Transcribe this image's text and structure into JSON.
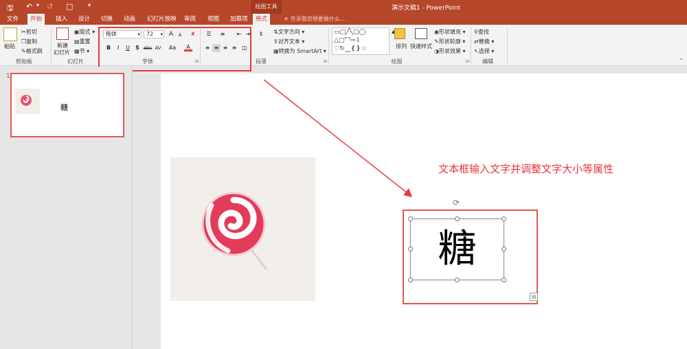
{
  "app": {
    "doc_title": "演示文稿1 - PowerPoint",
    "context_tab_group": "绘图工具",
    "tell_me_placeholder": "告诉我您想要做什么..."
  },
  "tabs": [
    "文件",
    "开始",
    "插入",
    "设计",
    "切换",
    "动画",
    "幻灯片放映",
    "审阅",
    "视图",
    "加载项",
    "格式"
  ],
  "active_tab": "开始",
  "ribbon": {
    "clipboard": {
      "paste": "粘贴",
      "cut": "剪切",
      "copy": "复制",
      "format_painter": "格式刷",
      "label": "剪贴板"
    },
    "slides": {
      "new_slide_1": "新建",
      "new_slide_2": "幻灯片",
      "layout": "版式",
      "reset": "重置",
      "section": "节",
      "label": "幻灯片"
    },
    "font": {
      "font_name": "楷体",
      "font_size": "72",
      "label": "字体",
      "bold": "B",
      "italic": "I",
      "underline": "U",
      "shadow": "S",
      "strike": "abc",
      "spacing": "AV",
      "case": "Aa",
      "grow": "A",
      "shrink": "A",
      "color": "A"
    },
    "paragraph": {
      "text_direction": "文字方向",
      "align_text": "对齐文本",
      "smartart": "转换为 SmartArt",
      "label": "段落"
    },
    "drawing": {
      "arrange": "排列",
      "quick_styles": "快速样式",
      "shape_fill": "形状填充",
      "shape_outline": "形状轮廓",
      "shape_effects": "形状效果",
      "label": "绘图"
    },
    "editing": {
      "find": "查找",
      "replace": "替换",
      "select": "选择",
      "label": "编辑"
    }
  },
  "thumbnail": {
    "number": "1",
    "text": "糖"
  },
  "slide": {
    "annotation": "文本框输入文字并调整文字大小等属性",
    "textbox_text": "糖"
  },
  "colors": {
    "accent": "#b7472a",
    "annotation": "#e8383d"
  }
}
